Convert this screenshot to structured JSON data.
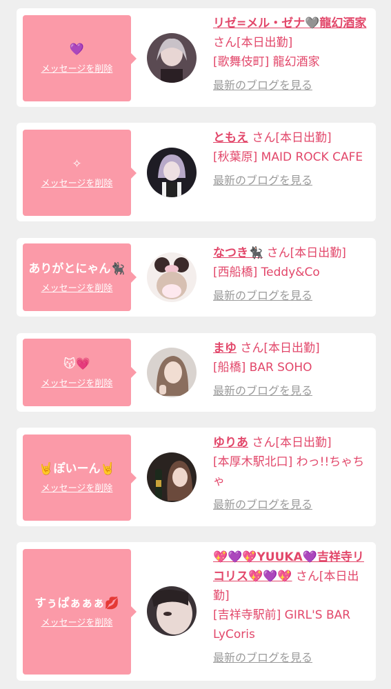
{
  "delete_label": "メッセージを削除",
  "blog_label": "最新のブログを見る",
  "cast": [
    {
      "message": "💜",
      "name": "リゼ=メル・ゼナ🩶龍幻酒家",
      "honorific": " さん",
      "status": "[本日出勤]",
      "shop": "[歌舞伎町] 龍幻酒家"
    },
    {
      "message": "✧",
      "name": "ともえ",
      "honorific": " さん",
      "status": "[本日出勤]",
      "shop": "[秋葉原] MAID ROCK CAFE"
    },
    {
      "message": "ありがとにゃん🐈‍⬛",
      "name": "なつき🐈‍⬛",
      "honorific": " さん",
      "status": "[本日出勤]",
      "shop": "[西船橋] Teddy&Co"
    },
    {
      "message": "😽💗",
      "name": "まゆ",
      "honorific": " さん",
      "status": "[本日出勤]",
      "shop": "[船橋] BAR SOHO"
    },
    {
      "message": "🤘ぽいーん🤘",
      "name": "ゆりあ",
      "honorific": " さん",
      "status": "[本日出勤]",
      "shop": "[本厚木駅北口] わっ!!ちゃちゃ"
    },
    {
      "message": "すぅぱぁぁぁ💋",
      "name": "💖💜💖YUUKA💜吉祥寺リコリス💖💜💖",
      "honorific": " さん",
      "status": "[本日出勤]",
      "shop": "[吉祥寺駅前] GIRL'S BAR LyCoris"
    }
  ],
  "colors": {
    "page_bg": "#efefef",
    "bubble": "#fb9aa8",
    "accent": "#e2476a",
    "link_gray": "#9b9b9b"
  }
}
